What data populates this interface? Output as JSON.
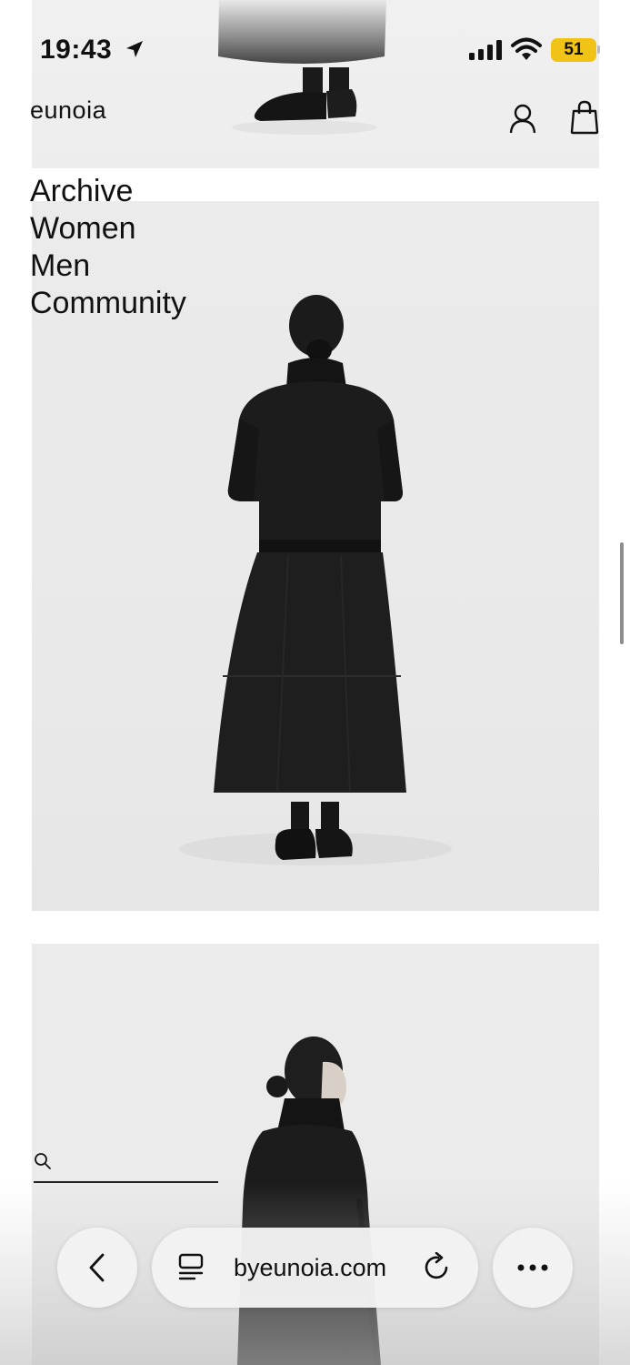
{
  "status_bar": {
    "time": "19:43",
    "battery": "51",
    "battery_color": "#f2c317",
    "icons": [
      "location-arrow-icon",
      "cellular-signal-icon",
      "wifi-icon",
      "battery-icon"
    ]
  },
  "header": {
    "logo": "eunoia",
    "icons": [
      "user-icon",
      "shopping-bag-icon"
    ]
  },
  "nav": {
    "items": [
      {
        "label": "Archive"
      },
      {
        "label": "Women"
      },
      {
        "label": "Men"
      },
      {
        "label": "Community"
      }
    ]
  },
  "search": {
    "icon": "search-icon",
    "value": ""
  },
  "browser": {
    "url": "byeunoia.com",
    "icons": [
      "back-chevron-icon",
      "tabs-icon",
      "reload-icon",
      "more-icon"
    ]
  },
  "colors": {
    "background": "#ffffff",
    "image_panel": "#ebebeb",
    "text": "#111111"
  }
}
